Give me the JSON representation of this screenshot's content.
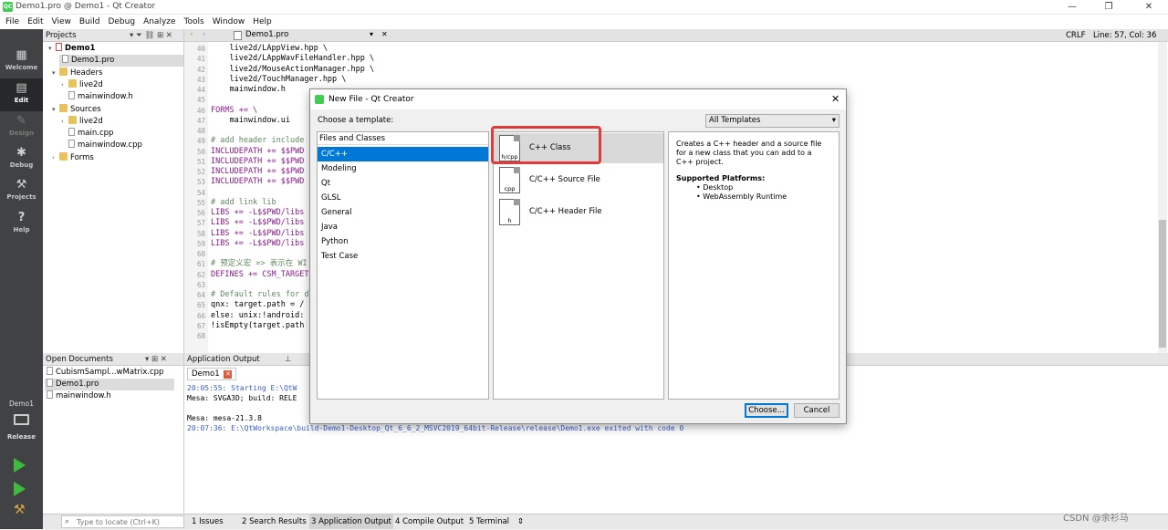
{
  "window": {
    "title": "Demo1.pro @ Demo1 - Qt Creator",
    "logo": "QC"
  },
  "menu": [
    "File",
    "Edit",
    "View",
    "Build",
    "Debug",
    "Analyze",
    "Tools",
    "Window",
    "Help"
  ],
  "modes": [
    {
      "label": "Welcome",
      "icon": "grid-icon"
    },
    {
      "label": "Edit",
      "icon": "edit-icon"
    },
    {
      "label": "Design",
      "icon": "pencil-icon"
    },
    {
      "label": "Debug",
      "icon": "bug-icon"
    },
    {
      "label": "Projects",
      "icon": "wrench-icon"
    },
    {
      "label": "Help",
      "icon": "help-icon"
    }
  ],
  "kit": {
    "project": "Demo1",
    "config": "Release"
  },
  "projects_pane": {
    "title": "Projects",
    "tree": [
      "Demo1",
      "Demo1.pro",
      "Headers",
      "live2d",
      "mainwindow.h",
      "Sources",
      "live2d",
      "main.cpp",
      "mainwindow.cpp",
      "Forms"
    ]
  },
  "editor": {
    "file_tab": "Demo1.pro",
    "line_ending": "CRLF",
    "cursor": "Line: 57, Col: 36",
    "lines": [
      {
        "n": "40",
        "t": "    live2d/LAppView.hpp \\"
      },
      {
        "n": "41",
        "t": "    live2d/LAppWavFileHandler.hpp \\"
      },
      {
        "n": "42",
        "t": "    live2d/MouseActionManager.hpp \\"
      },
      {
        "n": "43",
        "t": "    live2d/TouchManager.hpp \\"
      },
      {
        "n": "44",
        "t": "    mainwindow.h"
      },
      {
        "n": "45",
        "t": ""
      },
      {
        "n": "46",
        "t": "FORMS += \\"
      },
      {
        "n": "47",
        "t": "    mainwindow.ui"
      },
      {
        "n": "48",
        "t": ""
      },
      {
        "n": "49",
        "t": "# add header include"
      },
      {
        "n": "50",
        "t": "INCLUDEPATH += $$PWD"
      },
      {
        "n": "51",
        "t": "INCLUDEPATH += $$PWD"
      },
      {
        "n": "52",
        "t": "INCLUDEPATH += $$PWD"
      },
      {
        "n": "53",
        "t": "INCLUDEPATH += $$PWD"
      },
      {
        "n": "54",
        "t": ""
      },
      {
        "n": "55",
        "t": "# add link lib"
      },
      {
        "n": "56",
        "t": "LIBS += -L$$PWD/libs"
      },
      {
        "n": "57",
        "t": "LIBS += -L$$PWD/libs"
      },
      {
        "n": "58",
        "t": "LIBS += -L$$PWD/libs"
      },
      {
        "n": "59",
        "t": "LIBS += -L$$PWD/libs"
      },
      {
        "n": "60",
        "t": ""
      },
      {
        "n": "61",
        "t": "# 预定义宏 => 表示在 WI"
      },
      {
        "n": "62",
        "t": "DEFINES += CSM_TARGET"
      },
      {
        "n": "63",
        "t": ""
      },
      {
        "n": "64",
        "t": "# Default rules for d"
      },
      {
        "n": "65",
        "t": "qnx: target.path = /"
      },
      {
        "n": "66",
        "t": "else: unix:!android:"
      },
      {
        "n": "67",
        "t": "!isEmpty(target.path"
      },
      {
        "n": "68",
        "t": ""
      }
    ]
  },
  "open_documents": {
    "title": "Open Documents",
    "items": [
      "CubismSampl...wMatrix.cpp",
      "Demo1.pro",
      "mainwindow.h"
    ]
  },
  "app_output": {
    "title": "Application Output",
    "tab": "Demo1",
    "lines": [
      "20:05:55: Starting E:\\QtW",
      "Mesa: SVGA3D; build: RELE",
      "",
      "Mesa: mesa-21.3.8",
      "20:07:36: E:\\QtWorkspace\\build-Demo1-Desktop_Qt_6_6_2_MSVC2019_64bit-Release\\release\\Demo1.exe exited with code 0"
    ]
  },
  "statusbar": {
    "locate_placeholder": "Type to locate (Ctrl+K)",
    "tabs": [
      "1  Issues",
      "2  Search Results",
      "3  Application Output",
      "4  Compile Output",
      "5  Terminal"
    ],
    "watermark": "CSDN @余衫马"
  },
  "dialog": {
    "title": "New File - Qt Creator",
    "choose_label": "Choose a template:",
    "filter": "All Templates",
    "categories_header": "Files and Classes",
    "categories": [
      "C/C++",
      "Modeling",
      "Qt",
      "GLSL",
      "General",
      "Java",
      "Python",
      "Test Case"
    ],
    "templates": [
      {
        "label": "C++ Class",
        "icon_text": "h/cpp"
      },
      {
        "label": "C/C++ Source File",
        "icon_text": "cpp"
      },
      {
        "label": "C/C++ Header File",
        "icon_text": "h"
      }
    ],
    "description": "Creates a C++ header and a source file for a new class that you can add to a C++ project.",
    "platforms_title": "Supported Platforms",
    "platforms": [
      "Desktop",
      "WebAssembly Runtime"
    ],
    "choose_button": "Choose...",
    "cancel_button": "Cancel",
    "highlight_color": "#e03a3a"
  }
}
